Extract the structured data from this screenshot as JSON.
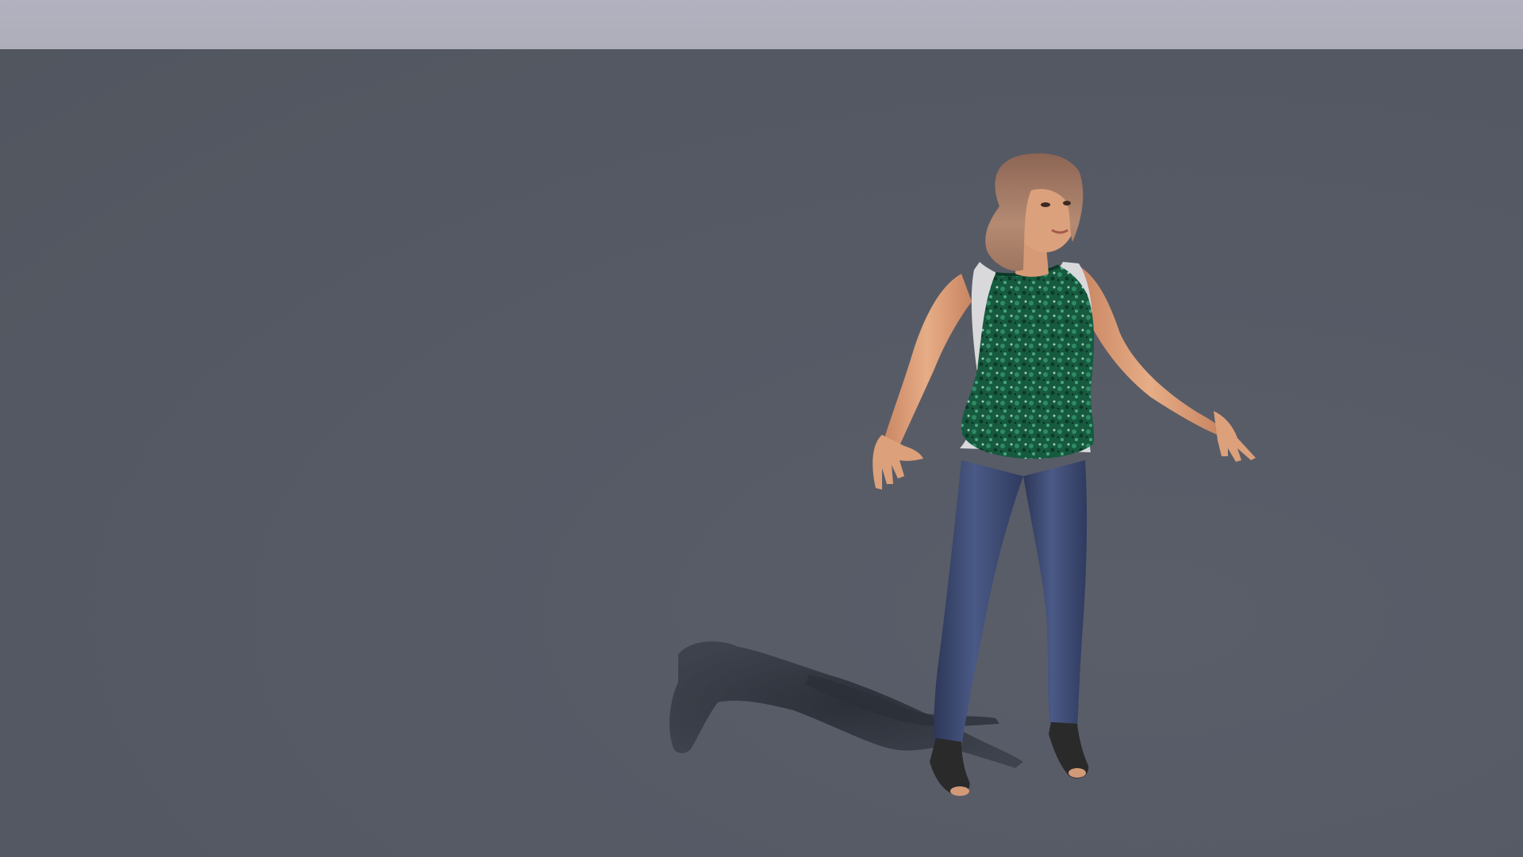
{
  "scene": {
    "subject": "3d-character",
    "colors": {
      "sky": "#b1b1bf",
      "ground": "#575b66",
      "shadow": "#2b2f38",
      "skin": "#e0a37c",
      "hair": "#a77c66",
      "top": "#1f6b4c",
      "tank": "#d9d9dc",
      "jeans": "#3b4a73",
      "shoes": "#2a2a2a"
    }
  }
}
